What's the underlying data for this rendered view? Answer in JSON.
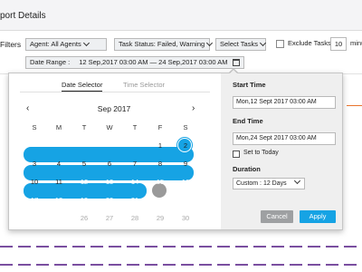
{
  "header": {
    "title": "port Details"
  },
  "filters": {
    "label": "Filters",
    "agent": "Agent: All Agents",
    "status": "Task Status: Failed, Warning",
    "tasks": "Select Tasks",
    "exclude_label": "Exclude Tasks <",
    "exclude_value": "10",
    "minutes_label": "minu",
    "date_range_label": "Date Range :",
    "date_range_value": "12 Sep,2017 03:00 AM — 24 Sep,2017 03:00 AM"
  },
  "popup": {
    "tabs": {
      "date": "Date Selector",
      "time": "Time Selector"
    },
    "month": "Sep 2017",
    "nav": {
      "prev": "‹",
      "next": "›"
    },
    "weekdays": [
      "S",
      "M",
      "T",
      "W",
      "T",
      "F",
      "S"
    ],
    "days": [
      "1",
      "2",
      "3",
      "4",
      "5",
      "6",
      "7",
      "8",
      "9",
      "10",
      "11",
      "12",
      "13",
      "14",
      "15",
      "16",
      "17",
      "18",
      "19",
      "20",
      "21",
      "22",
      "23",
      "24",
      "25",
      "26",
      "27",
      "28",
      "29",
      "30"
    ],
    "start_label": "Start Time",
    "start_value": "Mon,12 Sept 2017 03:00 AM",
    "end_label": "End Time",
    "end_value": "Mon,24 Sept 2017 03:00 AM",
    "set_today": "Set to Today",
    "duration_label": "Duration",
    "duration_value": "Custom : 12 Days",
    "cancel": "Cancel",
    "apply": "Apply"
  },
  "colors": {
    "accent": "#16a3e4",
    "today": "#9a9a9a",
    "dash": "#7a4fa0",
    "orange": "#e8742d"
  },
  "icons": [
    "chevron-down-icon",
    "calendar-icon",
    "chevron-left-icon",
    "chevron-right-icon"
  ]
}
